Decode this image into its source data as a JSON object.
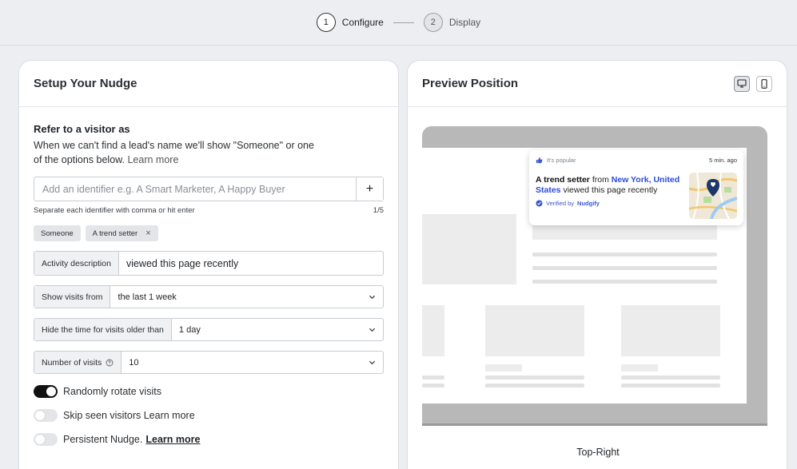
{
  "stepper": {
    "steps": [
      {
        "number": "1",
        "label": "Configure"
      },
      {
        "number": "2",
        "label": "Display"
      }
    ]
  },
  "setup": {
    "title": "Setup Your Nudge",
    "visitor_section": {
      "title": "Refer to a visitor as",
      "description": "When we can't find a lead's name we'll show \"Someone\" or one of the options below.",
      "learn_more": "Learn more",
      "input_placeholder": "Add an identifier e.g. A Smart Marketer, A Happy Buyer",
      "add_button": "+",
      "helper": "Separate each identifier with comma or hit enter",
      "count": "1/5",
      "chips": [
        "Someone",
        "A trend setter"
      ],
      "chip_remove": "×"
    },
    "activity": {
      "label": "Activity description",
      "value": "viewed this page recently"
    },
    "show_visits": {
      "label": "Show visits from",
      "value": "the last 1 week"
    },
    "hide_time": {
      "label": "Hide the time for visits older than",
      "value": "1 day"
    },
    "num_visits": {
      "label": "Number of visits",
      "value": "10"
    },
    "toggles": [
      {
        "label": "Randomly rotate visits",
        "on": true
      },
      {
        "label": "Skip seen visitors Learn more",
        "on": false
      },
      {
        "label": "Persistent Nudge.",
        "link": "Learn more",
        "on": false
      }
    ]
  },
  "preview": {
    "title": "Preview Position",
    "position": "Top-Right",
    "nudge": {
      "tag": "It's popular",
      "time": "5 min. ago",
      "name": "A trend setter",
      "from": "from",
      "location": "New York, United States",
      "activity": "viewed this page recently",
      "verified_prefix": "Verified by",
      "verified_brand": "Nudgify"
    }
  }
}
